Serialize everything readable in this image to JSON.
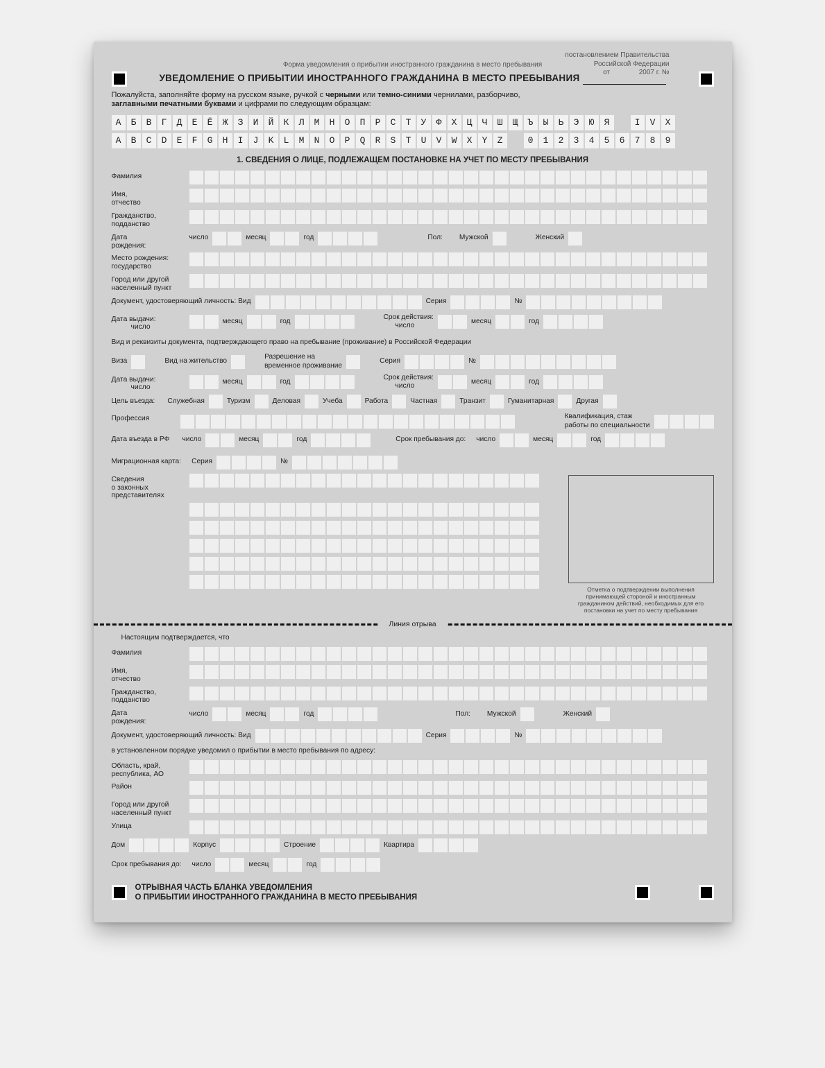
{
  "decree": {
    "l1": "постановлением Правительства",
    "l2": "Российской Федерации",
    "l3_prefix": "от",
    "l3_year": "2007 г.  №"
  },
  "formLabel": "Форма уведомления о прибытии иностранного гражданина в место пребывания",
  "title": "УВЕДОМЛЕНИЕ О ПРИБЫТИИ ИНОСТРАННОГО ГРАЖДАНИНА В МЕСТО ПРЕБЫВАНИЯ",
  "instr": {
    "t1": "Пожалуйста, заполняйте форму на русском языке, ручкой с ",
    "b1": "черными",
    "t2": " или ",
    "b2": "темно-синими",
    "t3": " чернилами, разборчиво,",
    "b3": "заглавными печатными буквами",
    "t4": " и цифрами по следующим образцам:"
  },
  "specimen": {
    "ru": [
      "А",
      "Б",
      "В",
      "Г",
      "Д",
      "Е",
      "Ё",
      "Ж",
      "З",
      "И",
      "Й",
      "К",
      "Л",
      "М",
      "Н",
      "О",
      "П",
      "Р",
      "С",
      "Т",
      "У",
      "Ф",
      "Х",
      "Ц",
      "Ч",
      "Ш",
      "Щ",
      "Ъ",
      "Ы",
      "Ь",
      "Э",
      "Ю",
      "Я"
    ],
    "rom": [
      "I",
      "V",
      "X"
    ],
    "lat": [
      "A",
      "B",
      "C",
      "D",
      "E",
      "F",
      "G",
      "H",
      "I",
      "J",
      "K",
      "L",
      "M",
      "N",
      "O",
      "P",
      "Q",
      "R",
      "S",
      "T",
      "U",
      "V",
      "W",
      "X",
      "Y",
      "Z"
    ],
    "dig": [
      "0",
      "1",
      "2",
      "3",
      "4",
      "5",
      "6",
      "7",
      "8",
      "9"
    ]
  },
  "section1": "1. СВЕДЕНИЯ О ЛИЦЕ, ПОДЛЕЖАЩЕМ ПОСТАНОВКЕ НА УЧЕТ ПО МЕСТУ ПРЕБЫВАНИЯ",
  "labels": {
    "surname": "Фамилия",
    "name": "Имя,\nотчество",
    "citizenship": "Гражданство,\nподданство",
    "dob": "Дата\nрождения:",
    "day": "число",
    "month": "месяц",
    "year": "год",
    "gender": "Пол:",
    "male": "Мужской",
    "female": "Женский",
    "birthCountry": "Место рождения:\nгосударство",
    "city": "Город или другой\nнаселенный пункт",
    "docId": "Документ, удостоверяющий личность:  Вид",
    "series": "Серия",
    "number": "№",
    "dateIssued": "Дата выдачи:",
    "validUntil": "Срок действия:",
    "stayDoc": "Вид и реквизиты документа, подтверждающего право на пребывание (проживание) в Российской Федерации",
    "visa": "Виза",
    "residPerm": "Вид на жительство",
    "tempPermit": "Разрешение на\nвременное проживание",
    "purpose": "Цель въезда:",
    "p_serv": "Служебная",
    "p_tour": "Туризм",
    "p_biz": "Деловая",
    "p_edu": "Учеба",
    "p_work": "Работа",
    "p_priv": "Частная",
    "p_trans": "Транзит",
    "p_hum": "Гуманитарная",
    "p_other": "Другая",
    "profession": "Профессия",
    "qualif": "Квалификация, стаж\nработы по специальности",
    "entryDate": "Дата въезда в РФ",
    "stayUntil": "Срок пребывания до:",
    "migCard": "Миграционная карта:",
    "reps": "Сведения\nо законных\nпредставителях",
    "noteCaption": "Отметка о подтверждении выполнения принимающей стороной и иностранным гражданином действий, необходимых для его постановки на учет по месту пребывания"
  },
  "tearLabel": "Линия отрыва",
  "tear": {
    "confirm": "Настоящим подтверждается, что",
    "addressNote": "в установленном порядке уведомил о прибытии в место пребывания по адресу:",
    "region": "Область, край,\nреспублика, АО",
    "district": "Район",
    "street": "Улица",
    "house": "Дом",
    "korpus": "Корпус",
    "building": "Строение",
    "flat": "Квартира",
    "footer1": "ОТРЫВНАЯ ЧАСТЬ БЛАНКА УВЕДОМЛЕНИЯ",
    "footer2": "О ПРИБЫТИИ ИНОСТРАННОГО ГРАЖДАНИНА В МЕСТО ПРЕБЫВАНИЯ"
  }
}
